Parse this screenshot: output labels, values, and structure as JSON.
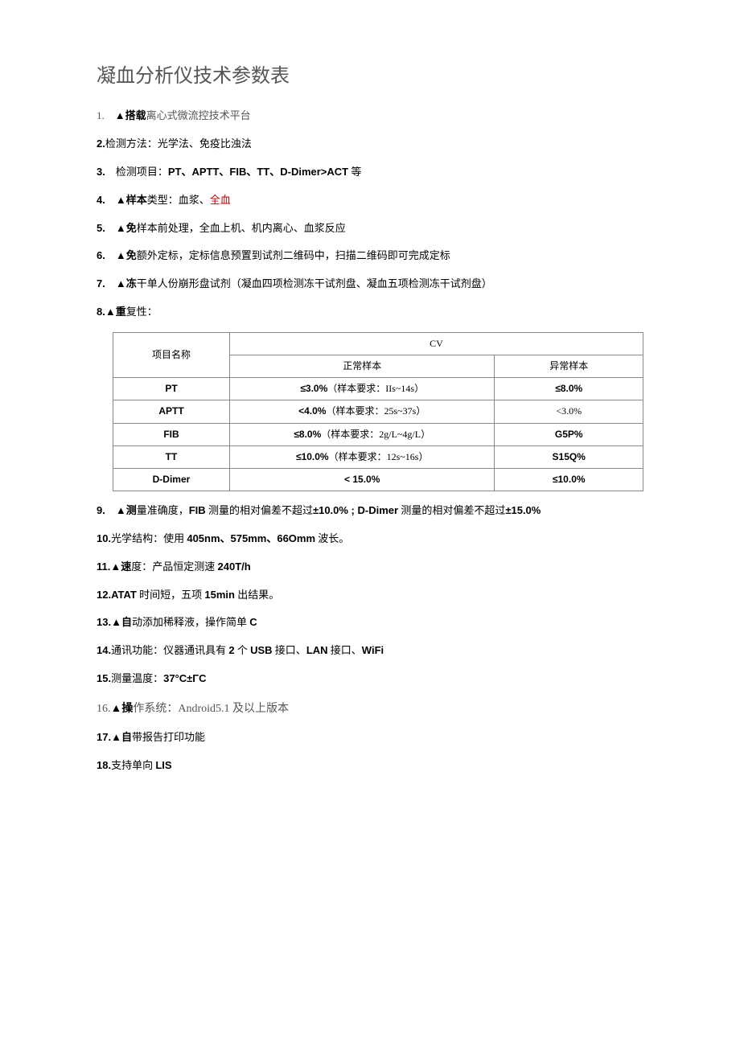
{
  "title": "凝血分析仪技术参数表",
  "items": {
    "i1": {
      "num": "1.",
      "text_a": "▲搭载",
      "text_b": "离心式微流控技术平台"
    },
    "i2": {
      "num": "2.",
      "text": "检测方法：光学法、免疫比浊法"
    },
    "i3": {
      "num": "3.",
      "label": "检测项目：",
      "val": "PT、APTT、FIB、TT、D-Dimer>ACT",
      "suffix": " 等"
    },
    "i4": {
      "num": "4.",
      "tri": "▲样本",
      "text": "类型：血浆、",
      "red": "全血"
    },
    "i5": {
      "num": "5.",
      "tri": "▲免",
      "text": "样本前处理，全血上机、机内离心、血浆反应"
    },
    "i6": {
      "num": "6.",
      "tri": "▲免",
      "text": "额外定标，定标信息预置到试剂二维码中，扫描二维码即可完成定标"
    },
    "i7": {
      "num": "7.",
      "tri": "▲冻",
      "text": "干单人份崩形盘试剂（凝血四项检测冻干试剂盘、凝血五项检测冻干试剂盘）"
    },
    "i8": {
      "num": "8.",
      "tri": "▲重",
      "text": "复性："
    },
    "i9": {
      "num": "9.",
      "tri": "▲测",
      "text_a": "量准确度，",
      "bold_a": "FIB",
      "text_b": " 测量的相对偏差不超过",
      "bold_b": "±10.0% ; D-Dimer",
      "text_c": " 测量的相对偏差不超过",
      "bold_c": "±15.0%"
    },
    "i10": {
      "num": "10.",
      "text_a": "光学结构：使用 ",
      "bold": "405nm、575mm、66Omm",
      "text_b": " 波长。"
    },
    "i11": {
      "num": "11.",
      "tri": "▲速",
      "text_a": "度：产品恒定测速 ",
      "bold": "240T/h"
    },
    "i12": {
      "num": "12.",
      "bold_a": "ATAT",
      "text_a": " 时间短，五项 ",
      "bold_b": "15min",
      "text_b": " 出结果。"
    },
    "i13": {
      "num": "13.",
      "tri": "▲自",
      "text_a": "动添加稀释液，操作简单 ",
      "bold": "C"
    },
    "i14": {
      "num": "14.",
      "text_a": "通讯功能：仪器通讯具有 ",
      "bold_a": "2",
      "text_b": " 个 ",
      "bold_b": "USB",
      "text_c": " 接口、",
      "bold_c": "LAN",
      "text_d": " 接口、",
      "bold_d": "WiFi"
    },
    "i15": {
      "num": "15.",
      "text": "测量温度：",
      "bold": "37°C±ΓC"
    },
    "i16": {
      "num": "16.",
      "tri": "▲操",
      "text_a": "作系统：",
      "mid": "Android5.1",
      "text_b": " 及以上版本"
    },
    "i17": {
      "num": "17.",
      "tri": "▲自",
      "text": "带报告打印功能"
    },
    "i18": {
      "num": "18.",
      "text_a": "支持单向 ",
      "bold": "LIS"
    }
  },
  "table": {
    "header": {
      "name": "项目名称",
      "cv": "CV",
      "normal": "正常样本",
      "abnormal": "异常样本"
    },
    "rows": [
      {
        "name": "PT",
        "normal_val": "≤3.0%",
        "normal_req": "（样本要求：IIs~14s）",
        "abnormal": "≤8.0%"
      },
      {
        "name": "APTT",
        "normal_val": "<4.0%",
        "normal_req": "（样本要求：25s~37s）",
        "abnormal": "<3.0%"
      },
      {
        "name": "FIB",
        "normal_val": "≤8.0%",
        "normal_req": "（样本要求：2g/L~4g/L）",
        "abnormal": "G5P%"
      },
      {
        "name": "TT",
        "normal_val": "≤10.0%",
        "normal_req": "（样本要求：12s~16s）",
        "abnormal": "S15Q%"
      },
      {
        "name": "D-Dimer",
        "normal_val": "",
        "normal_req": "< 15.0%",
        "abnormal": "≤10.0%"
      }
    ]
  }
}
